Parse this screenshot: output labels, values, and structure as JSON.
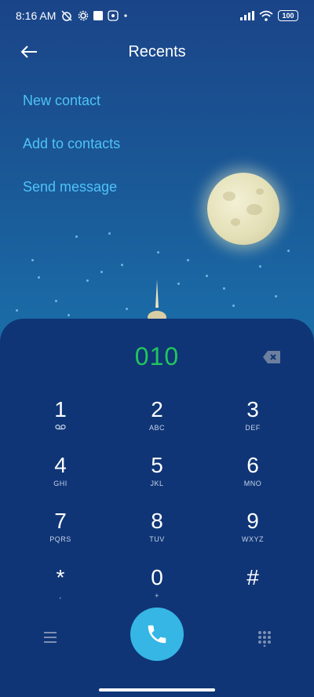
{
  "status_bar": {
    "time": "8:16 AM",
    "left_icons": [
      "alarm-off-icon",
      "settings-gear-icon",
      "square-notification-icon",
      "app-notification-icon",
      "dot-icon"
    ],
    "right_icons": [
      "signal-icon",
      "wifi-icon"
    ],
    "battery": "100"
  },
  "header": {
    "title": "Recents"
  },
  "actions": {
    "new_contact": "New contact",
    "add_to_contacts": "Add to contacts",
    "send_message": "Send message"
  },
  "dialer": {
    "number": "010",
    "keys": [
      {
        "digit": "1",
        "letters": "",
        "voicemail": true
      },
      {
        "digit": "2",
        "letters": "ABC"
      },
      {
        "digit": "3",
        "letters": "DEF"
      },
      {
        "digit": "4",
        "letters": "GHI"
      },
      {
        "digit": "5",
        "letters": "JKL"
      },
      {
        "digit": "6",
        "letters": "MNO"
      },
      {
        "digit": "7",
        "letters": "PQRS"
      },
      {
        "digit": "8",
        "letters": "TUV"
      },
      {
        "digit": "9",
        "letters": "WXYZ"
      },
      {
        "digit": "*",
        "letters": ","
      },
      {
        "digit": "0",
        "letters": "+"
      },
      {
        "digit": "#",
        "letters": ""
      }
    ]
  },
  "colors": {
    "background": "#0f3576",
    "accent": "#4fc3f7",
    "number": "#22c55e",
    "call_button": "#36b6e5"
  }
}
